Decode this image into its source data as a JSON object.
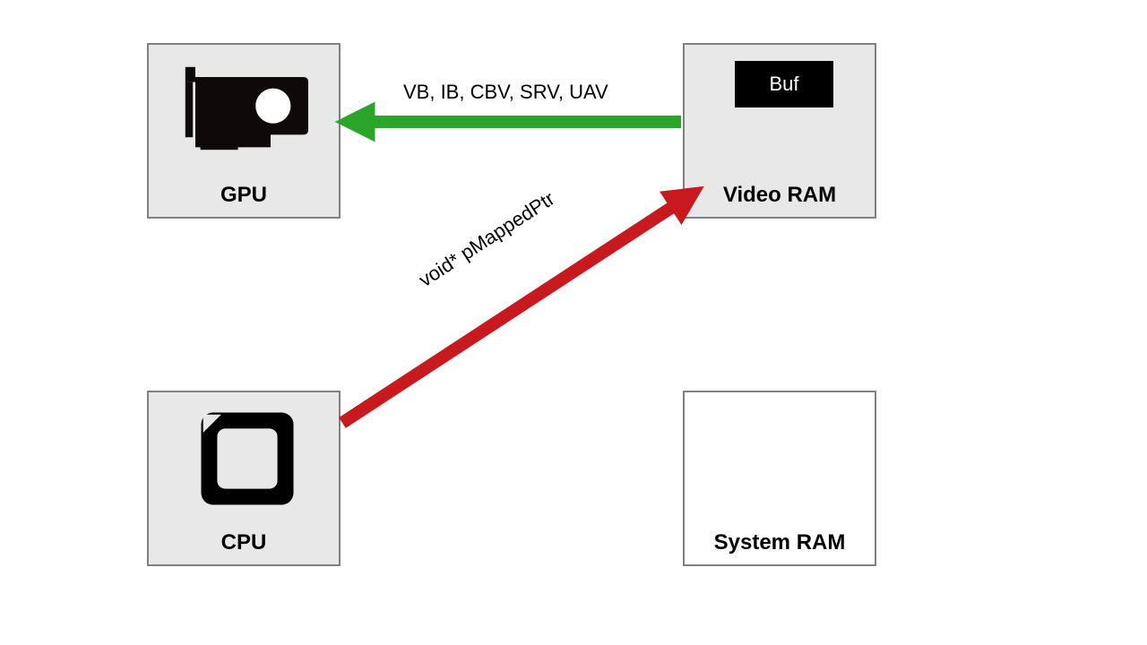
{
  "nodes": {
    "gpu": {
      "label": "GPU"
    },
    "cpu": {
      "label": "CPU"
    },
    "video_ram": {
      "label": "Video RAM"
    },
    "system_ram": {
      "label": "System RAM"
    },
    "buf": {
      "label": "Buf"
    }
  },
  "arrows": {
    "green": {
      "label": "VB, IB, CBV, SRV, UAV",
      "color": "#2aa52a"
    },
    "red": {
      "label": "void* pMappedPtr",
      "color": "#c8191f"
    }
  },
  "colors": {
    "box_fill": "#e8e8e8",
    "box_border": "#808080",
    "buf_bg": "#000000",
    "buf_fg": "#ffffff"
  }
}
